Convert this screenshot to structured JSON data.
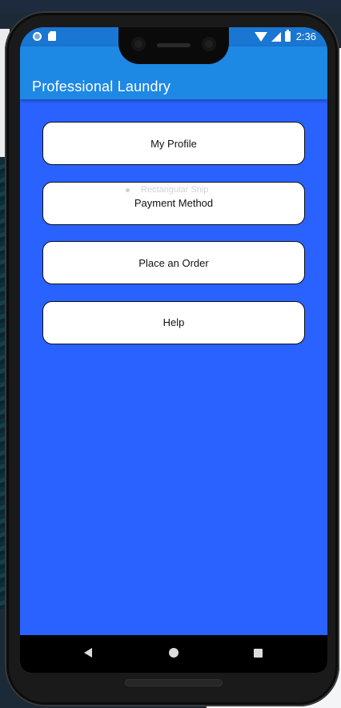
{
  "status_bar": {
    "time": "2:36",
    "icons": [
      "notification-dot-icon",
      "sd-card-icon",
      "wifi-icon",
      "signal-icon",
      "battery-icon"
    ]
  },
  "app_bar": {
    "title": "Professional Laundry",
    "color": "#1e88e5"
  },
  "menu": {
    "items": [
      {
        "label": "My Profile"
      },
      {
        "label": "Payment Method"
      },
      {
        "label": "Place an Order"
      },
      {
        "label": "Help"
      }
    ]
  },
  "overlay": {
    "tooltip": "Rectangular Snip"
  },
  "nav_bar": {
    "icons": [
      "back-icon",
      "home-icon",
      "recents-icon"
    ]
  },
  "colors": {
    "background": "#2962ff",
    "status_bar": "#1976d2",
    "button": "#ffffff"
  }
}
